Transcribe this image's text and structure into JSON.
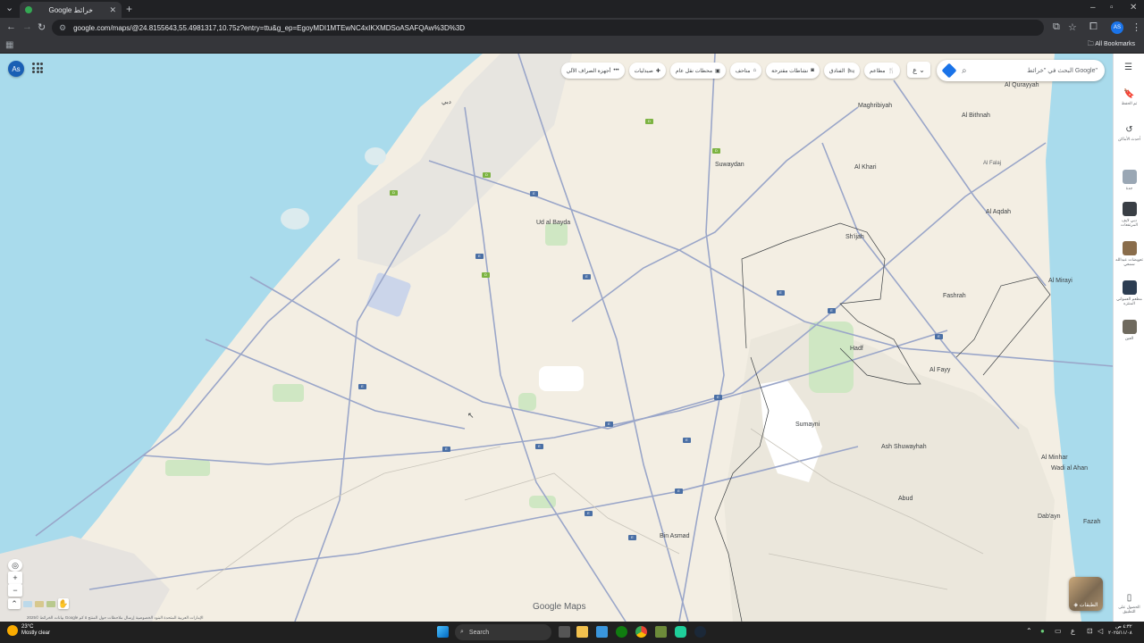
{
  "browser": {
    "tab_title": "Google خرائط",
    "url": "google.com/maps/@24.8155643,55.4981317,10.75z?entry=ttu&g_ep=EgoyMDI1MTEwNC4xIKXMDSoASAFQAw%3D%3D",
    "profile_initials": "AS",
    "all_bookmarks": "All Bookmarks"
  },
  "map": {
    "account_initials": "As",
    "search_placeholder": "البحث في \"خرائط Google\"",
    "layer_chip_label": "ع",
    "chips": [
      {
        "label": "مطاعم",
        "icon": "restaurant-icon"
      },
      {
        "label": "الفنادق",
        "icon": "hotel-icon"
      },
      {
        "label": "نشاطات مقترحة",
        "icon": "camera-icon"
      },
      {
        "label": "متاحف",
        "icon": "museum-icon"
      },
      {
        "label": "محطات نقل عام",
        "icon": "transit-icon"
      },
      {
        "label": "صيدليات",
        "icon": "pharmacy-icon"
      },
      {
        "label": "أجهزة الصراف الآلي",
        "icon": "more-icon"
      }
    ],
    "labels": {
      "dubai": "دبي",
      "suwaydan": "Suwaydan",
      "ud_al_bayda": "Ud al Bayda",
      "al_khari": "Al Khari",
      "maghribiyah": "Maghribiyah",
      "al_bithnah": "Al Bithnah",
      "al_qurayyah": "Al Qurayyah",
      "al_aqdah": "Al Aqdah",
      "siji": "Sh'ijah",
      "fashrah": "Fashrah",
      "al_mirayi": "Al Mirayi",
      "hadf": "Hadf",
      "al_fayy": "Al Fayy",
      "sumayni": "Sumayni",
      "ash_shuwayhah": "Ash Shuwayhah",
      "abud": "Abud",
      "al_minhar": "Al Minhar",
      "wadi_al_ahan": "Wadi al Ahan",
      "dabayn": "Dab'ayn",
      "fazah": "Fazah",
      "bin_asmad": "Bin Asmad",
      "al_falaj": "Al Falaj"
    },
    "layers_label": "الطبقات",
    "brand": "Google Maps",
    "credits": "بيانات الخرائط ©2025 Google   الإمارات العربية المتحدة   البنود   الخصوصية   إرسال ملاحظات حول المنتج   ٥ كم"
  },
  "rightbar": [
    {
      "label": "تم الحفظ",
      "icon": "bookmark-icon"
    },
    {
      "label": "أحدث الأماكن",
      "icon": "history-icon"
    },
    {
      "label": "جدة",
      "thumb": "#9aa7b4"
    },
    {
      "label": "دبي لايف المرتفعات",
      "thumb": "#3a3f45"
    },
    {
      "label": "تعويضات عبدالله سمعي",
      "thumb": "#8a6d4b"
    },
    {
      "label": "مطعم العمواني المنتزه",
      "thumb": "#2c3d52"
    },
    {
      "label": "العين",
      "thumb": "#6f6a5e"
    },
    {
      "label": "الحصول على التطبيق",
      "icon": "phone-icon"
    }
  ],
  "taskbar": {
    "temp": "23°C",
    "condition": "Mostly clear",
    "search": "Search",
    "time": "٤:٣٢ ص",
    "date": "٢٠٢٥/١١/٠٨"
  }
}
